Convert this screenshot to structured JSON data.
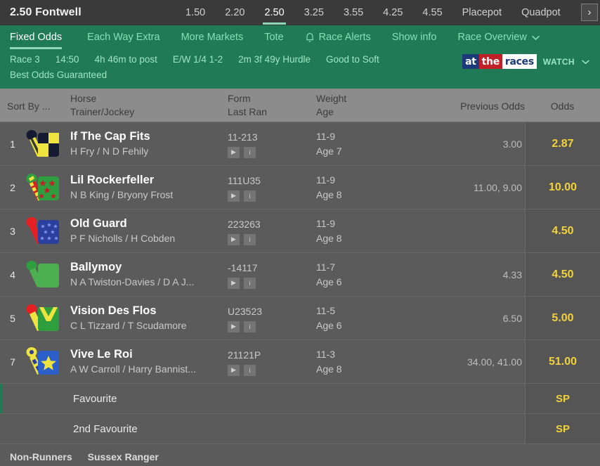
{
  "topbar": {
    "race_title": "2.50 Fontwell",
    "tabs": [
      {
        "label": "1.50",
        "active": false
      },
      {
        "label": "2.20",
        "active": false
      },
      {
        "label": "2.50",
        "active": true
      },
      {
        "label": "3.25",
        "active": false
      },
      {
        "label": "3.55",
        "active": false
      },
      {
        "label": "4.25",
        "active": false
      },
      {
        "label": "4.55",
        "active": false
      },
      {
        "label": "Placepot",
        "active": false
      },
      {
        "label": "Quadpot",
        "active": false
      }
    ],
    "next_arrow": "›"
  },
  "nav": {
    "items": [
      {
        "label": "Fixed Odds",
        "active": true,
        "icon": null,
        "caret": false
      },
      {
        "label": "Each Way Extra",
        "active": false,
        "icon": null,
        "caret": false
      },
      {
        "label": "More Markets",
        "active": false,
        "icon": null,
        "caret": false
      },
      {
        "label": "Tote",
        "active": false,
        "icon": null,
        "caret": false
      },
      {
        "label": "Race Alerts",
        "active": false,
        "icon": "bell-icon",
        "caret": false
      },
      {
        "label": "Show info",
        "active": false,
        "icon": null,
        "caret": false
      },
      {
        "label": "Race Overview",
        "active": false,
        "icon": null,
        "caret": true
      }
    ]
  },
  "info": {
    "items": [
      "Race 3",
      "14:50",
      "4h 46m to post",
      "E/W 1/4 1-2",
      "2m 3f 49y Hurdle",
      "Good to Soft"
    ],
    "second_row": "Best Odds Guaranteed",
    "broadcaster": {
      "at": "at",
      "the": "the",
      "races": "races",
      "watch": "WATCH",
      "caret": "⌄"
    }
  },
  "table": {
    "headers": {
      "sort_by": "Sort By ...",
      "horse": "Horse",
      "trainer_jockey": "Trainer/Jockey",
      "form": "Form",
      "last_ran": "Last Ran",
      "weight": "Weight",
      "age": "Age",
      "previous_odds": "Previous Odds",
      "odds": "Odds"
    },
    "runners": [
      {
        "number": "1",
        "horse": "If The Cap Fits",
        "trainer_jockey": "H Fry / N D Fehily",
        "form": "11-213",
        "weight": "11-9",
        "age": "Age 7",
        "previous_odds": "3.00",
        "odds": "2.87",
        "silk": "navy-yellow-quarters"
      },
      {
        "number": "2",
        "horse": "Lil Rockerfeller",
        "trainer_jockey": "N B King / Bryony Frost",
        "form": "111U35",
        "weight": "11-9",
        "age": "Age 8",
        "previous_odds": "11.00, 9.00",
        "odds": "10.00",
        "silk": "green-red-stars"
      },
      {
        "number": "3",
        "horse": "Old Guard",
        "trainer_jockey": "P F Nicholls / H Cobden",
        "form": "223263",
        "weight": "11-9",
        "age": "Age 8",
        "previous_odds": "",
        "odds": "4.50",
        "silk": "blue-stars-red-sleeve"
      },
      {
        "number": "4",
        "horse": "Ballymoy",
        "trainer_jockey": "N A Twiston-Davies / D A J...",
        "form": "-14117",
        "weight": "11-7",
        "age": "Age 6",
        "previous_odds": "4.33",
        "odds": "4.50",
        "silk": "all-green"
      },
      {
        "number": "5",
        "horse": "Vision Des Flos",
        "trainer_jockey": "C L Tizzard / T Scudamore",
        "form": "U23523",
        "weight": "11-5",
        "age": "Age 6",
        "previous_odds": "6.50",
        "odds": "5.00",
        "silk": "green-yellow-chevron"
      },
      {
        "number": "7",
        "horse": "Vive Le Roi",
        "trainer_jockey": "A W Carroll / Harry Bannist...",
        "form": "21121P",
        "weight": "11-3",
        "age": "Age 8",
        "previous_odds": "34.00, 41.00",
        "odds": "51.00",
        "silk": "blue-yellow-star"
      }
    ],
    "special_rows": [
      {
        "label": "Favourite",
        "odds": "SP"
      },
      {
        "label": "2nd Favourite",
        "odds": "SP"
      }
    ],
    "row_icons": {
      "video": "▶",
      "info": "i"
    }
  },
  "footer": {
    "non_runners_label": "Non-Runners",
    "non_runner_name": "Sussex Ranger"
  },
  "colors": {
    "brand_green": "#1f7a55",
    "accent_green": "#8fd8b8",
    "odds_yellow": "#f2d23c",
    "panel_grey": "#5b5b5b",
    "header_grey": "#8c8c8c",
    "topbar_grey": "#3a3a3a"
  }
}
